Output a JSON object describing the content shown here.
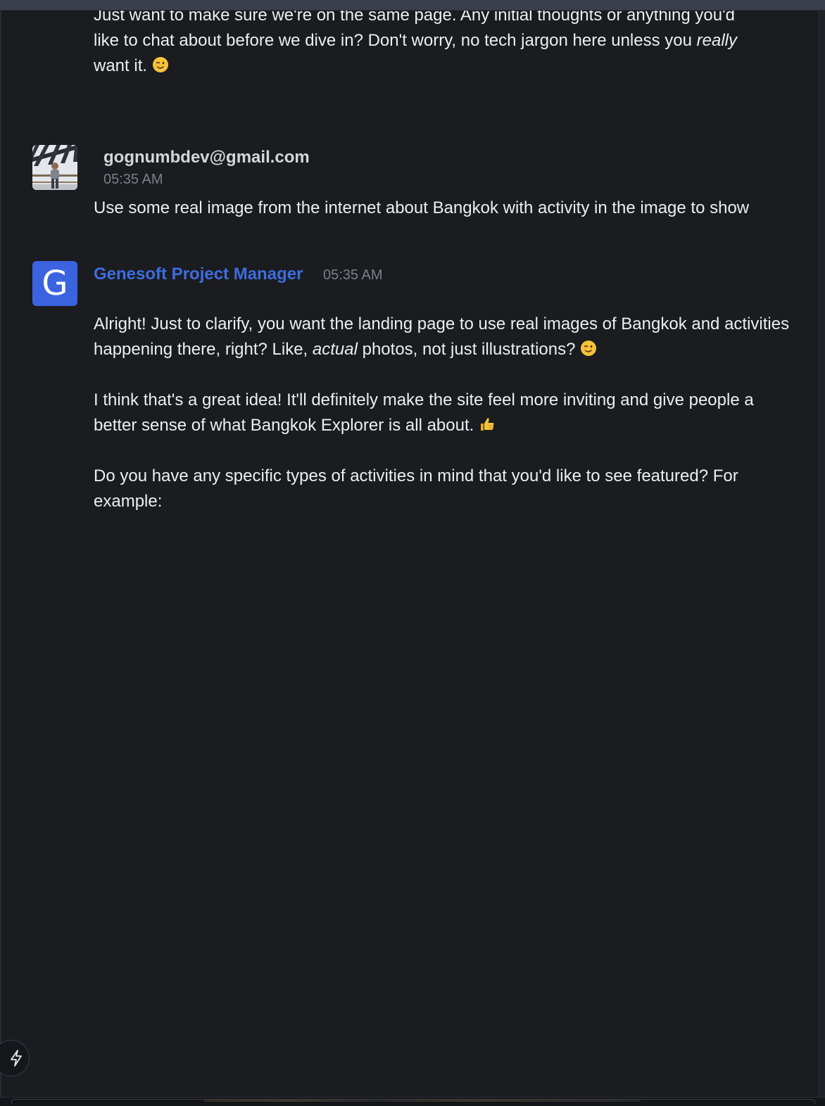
{
  "previous_message": {
    "line1": "Just want to make sure we're on the same page. Any initial thoughts or anything you'd",
    "line2_before": "like to chat about before we dive in? Don't worry, no tech jargon here unless you ",
    "line2_em": "really",
    "line3": "want it. ",
    "emoji": "wink-emoji"
  },
  "user_message": {
    "author": "gognumbdev@gmail.com",
    "time": "05:35 AM",
    "text": "Use some real image from the internet about Bangkok with activity in the image to show",
    "avatar": "user-photo-avatar"
  },
  "pm_message": {
    "author": "Genesoft Project Manager",
    "avatar_letter": "G",
    "time": "05:35 AM",
    "p1_before": "Alright! Just to clarify, you want the landing page to use real images of Bangkok and activities happening there, right? Like, ",
    "p1_em": "actual",
    "p1_after": " photos, not just illustrations? ",
    "p1_emoji": "wink-emoji",
    "p2": "I think that's a great idea! It'll definitely make the site feel more inviting and give people a better sense of what Bangkok Explorer is all about. ",
    "p2_emoji": "thumbs-up-emoji",
    "p3": "Do you have any specific types of activities in mind that you'd like to see featured? For example:"
  },
  "colors": {
    "background": "#1b1c20",
    "pm_name": "#3d6cdf",
    "pm_avatar": "#3b63e0",
    "timestamp": "#7b7f88"
  },
  "fab_icon": "lightning-icon"
}
